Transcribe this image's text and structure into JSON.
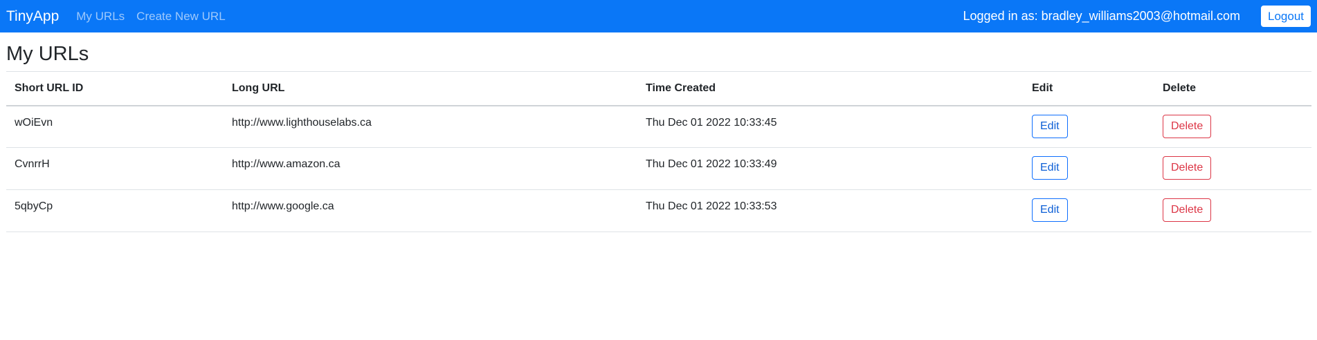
{
  "navbar": {
    "brand": "TinyApp",
    "links": [
      {
        "label": "My URLs"
      },
      {
        "label": "Create New URL"
      }
    ],
    "logged_in_text": "Logged in as: bradley_williams2003@hotmail.com",
    "logout_label": "Logout",
    "background_color": "#0a77f7"
  },
  "main": {
    "title": "My URLs",
    "table": {
      "headers": [
        "Short URL ID",
        "Long URL",
        "Time Created",
        "Edit",
        "Delete"
      ],
      "rows": [
        {
          "short_id": "wOiEvn",
          "long_url": "http://www.lighthouselabs.ca",
          "time": "Thu Dec 01 2022 10:33:45",
          "edit_label": "Edit",
          "delete_label": "Delete"
        },
        {
          "short_id": "CvnrrH",
          "long_url": "http://www.amazon.ca",
          "time": "Thu Dec 01 2022 10:33:49",
          "edit_label": "Edit",
          "delete_label": "Delete"
        },
        {
          "short_id": "5qbyCp",
          "long_url": "http://www.google.ca",
          "time": "Thu Dec 01 2022 10:33:53",
          "edit_label": "Edit",
          "delete_label": "Delete"
        }
      ]
    }
  },
  "colors": {
    "edit_button": "#0d6efd",
    "delete_button": "#dc3545"
  }
}
